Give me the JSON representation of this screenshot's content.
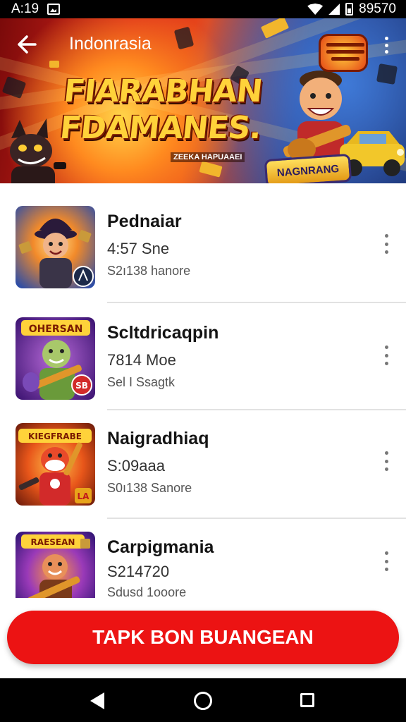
{
  "status_bar": {
    "time": "A:19",
    "battery": "89570",
    "icons": [
      "image-icon",
      "wifi-icon",
      "signal-icon",
      "battery-icon"
    ]
  },
  "header": {
    "location": "Indonrasia",
    "back_icon": "arrow-left-icon",
    "more_icon": "more-vert-icon"
  },
  "banner": {
    "title_line1": "FIARABHAN",
    "title_line2": "FDAMANES.",
    "subtitle": "ZEEKA HAPUAAEI",
    "ribbon": "NAGNRANG"
  },
  "items": [
    {
      "title": "Pednaiar",
      "meta": "4:57 Sne",
      "sub": "S2ı138 hanore",
      "thumb_bg": "#2a6cc8",
      "thumb_accent": "#ffb020",
      "thumb_label": ""
    },
    {
      "title": "Scltdricaqpin",
      "meta": "7814 Moe",
      "sub": "Sel I Ssagtk",
      "thumb_bg": "#6a2aa8",
      "thumb_accent": "#ffd23a",
      "thumb_label": "OHERSAN"
    },
    {
      "title": "Naigradhiaq",
      "meta": "S:09aaa",
      "sub": "S0ı138 Sanore",
      "thumb_bg": "#d9421a",
      "thumb_accent": "#ffd23a",
      "thumb_label": "KIEGFRABE"
    },
    {
      "title": "Carpigmania",
      "meta": "S214720",
      "sub": "Sdusd 1ooore",
      "thumb_bg": "#5a2ab0",
      "thumb_accent": "#ffd23a",
      "thumb_label": "RAESEAN"
    }
  ],
  "cta": {
    "label": "TAPK  BON BUANGEAN"
  },
  "nav": {
    "back": "back-icon",
    "home": "home-icon",
    "recents": "recents-icon"
  },
  "colors": {
    "accent": "#ec1313",
    "status_bar": "#000000",
    "nav_bar": "#000000"
  }
}
